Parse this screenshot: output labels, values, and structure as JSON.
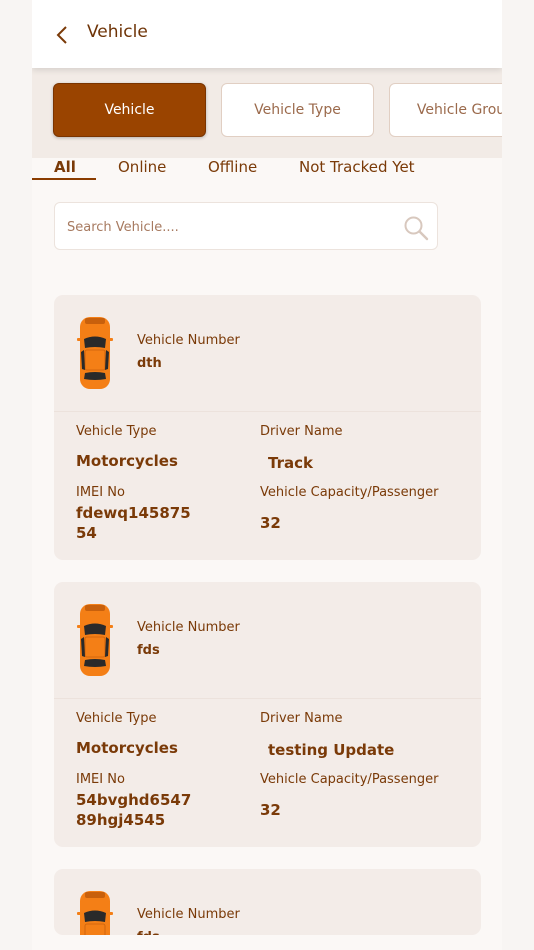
{
  "header": {
    "title": "Vehicle"
  },
  "segments": [
    "Vehicle",
    "Vehicle Type",
    "Vehicle Group"
  ],
  "filters": [
    "All",
    "Online",
    "Offline",
    "Not Tracked Yet"
  ],
  "search": {
    "placeholder": "Search Vehicle...."
  },
  "labels": {
    "vehicle_number": "Vehicle Number",
    "vehicle_type": "Vehicle Type",
    "driver_name": "Driver Name",
    "imei_no": "IMEI No",
    "capacity": "Vehicle Capacity/Passenger"
  },
  "vehicles": [
    {
      "number": "dth",
      "type": "Motorcycles",
      "driver": "Track",
      "imei_line1": "fdewq145875",
      "imei_line2": "54",
      "capacity": "32"
    },
    {
      "number": "fds",
      "type": "Motorcycles",
      "driver": "testing Update",
      "imei_line1": "54bvghd6547",
      "imei_line2": "89hgj4545",
      "capacity": "32"
    },
    {
      "number": "fds"
    }
  ],
  "colors": {
    "accent": "#9a4400",
    "text": "#7a3a08",
    "card": "#f3ece8",
    "car_body": "#f47f16"
  }
}
